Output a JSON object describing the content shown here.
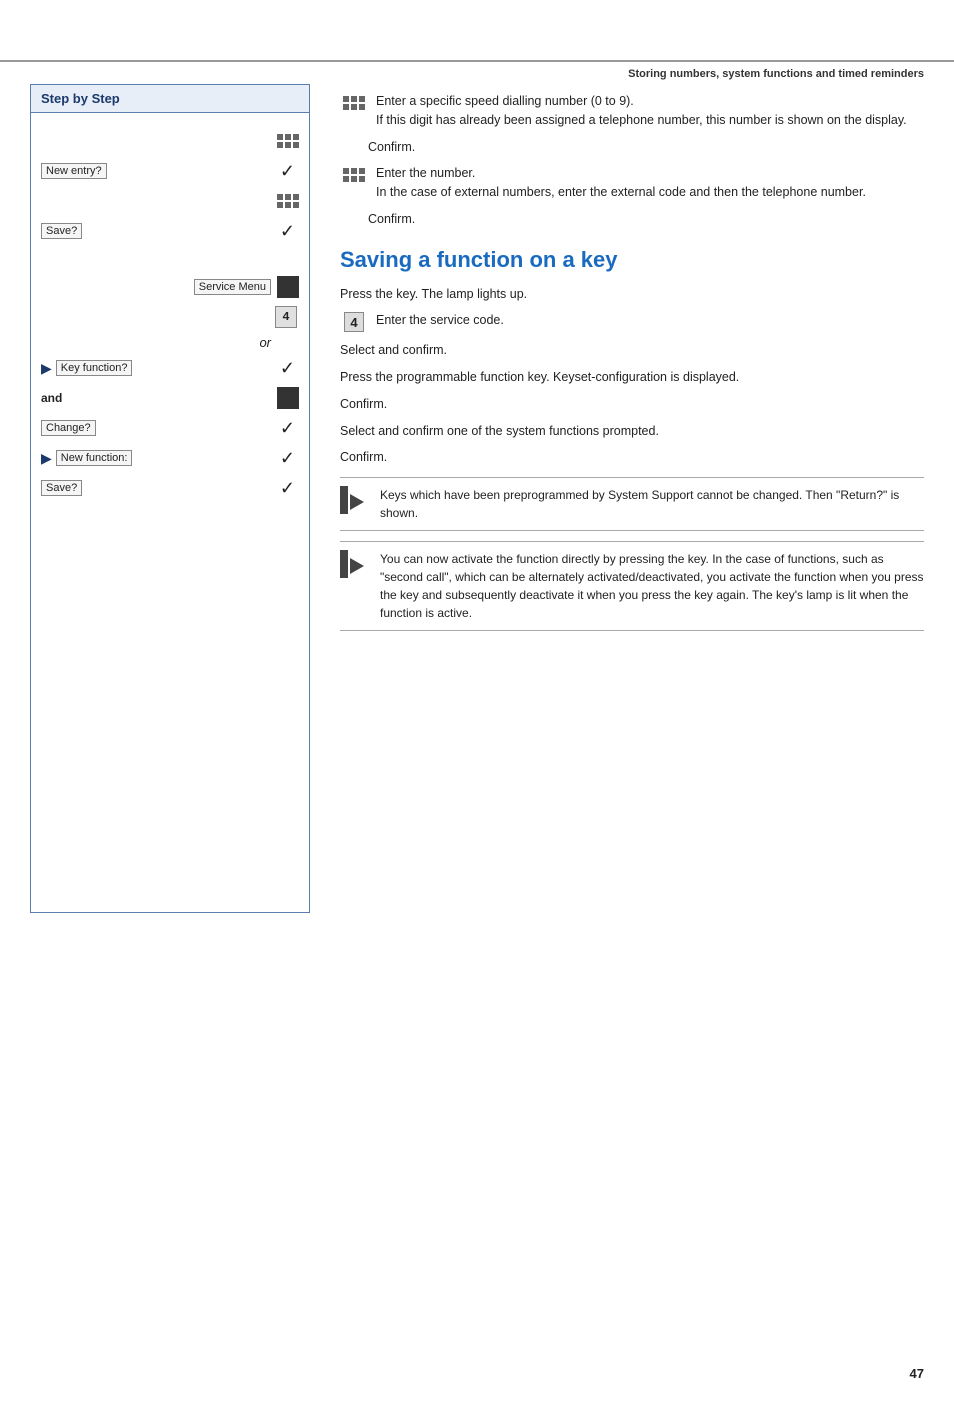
{
  "header": {
    "title": "Storing numbers, system functions and timed reminders"
  },
  "left": {
    "step_by_step_label": "Step by Step",
    "steps": [
      {
        "id": "speed-dial-icon",
        "type": "icon-check",
        "icon": "grid"
      },
      {
        "id": "new-entry",
        "type": "label-check",
        "label": "New entry?"
      },
      {
        "id": "number-icon",
        "type": "icon-check",
        "icon": "grid"
      },
      {
        "id": "save1",
        "type": "label-check",
        "label": "Save?"
      },
      {
        "id": "spacer1",
        "type": "spacer"
      },
      {
        "id": "service-menu",
        "type": "service-menu",
        "label": "Service Menu"
      },
      {
        "id": "digit4",
        "type": "digit",
        "digit": "4"
      },
      {
        "id": "or",
        "type": "or"
      },
      {
        "id": "key-function",
        "type": "arrow-label-check",
        "label": "Key function?"
      },
      {
        "id": "and-key",
        "type": "and-key"
      },
      {
        "id": "change",
        "type": "label-check",
        "label": "Change?"
      },
      {
        "id": "new-function",
        "type": "arrow-label-check",
        "label": "New function:"
      },
      {
        "id": "save2",
        "type": "label-check",
        "label": "Save?"
      }
    ]
  },
  "right": {
    "intro_items": [
      {
        "id": "speed-dial-intro",
        "icon": "grid",
        "text": "Enter a specific speed dialling number (0 to 9). If this digit has already been assigned a telephone number, this number is shown on the display."
      },
      {
        "id": "confirm1",
        "icon": "check",
        "text": "Confirm."
      },
      {
        "id": "enter-number",
        "icon": "grid",
        "text": "Enter the number. In the case of external numbers, enter the external code and then the telephone number."
      },
      {
        "id": "confirm2",
        "icon": "check",
        "text": "Confirm."
      }
    ],
    "section_heading": "Saving a function on a key",
    "section_items": [
      {
        "id": "press-key",
        "text": "Press the key. The lamp lights up."
      },
      {
        "id": "enter-service-code",
        "text": "Enter the service code."
      },
      {
        "id": "select-confirm",
        "text": "Select and confirm."
      },
      {
        "id": "press-prog-key",
        "text": "Press the programmable function key. Keyset-configuration is displayed."
      },
      {
        "id": "confirm3",
        "text": "Confirm."
      },
      {
        "id": "select-confirm2",
        "text": "Select and confirm one of the system functions prompted."
      },
      {
        "id": "confirm4",
        "text": "Confirm."
      }
    ],
    "info_boxes": [
      {
        "id": "info1",
        "text": "Keys which have been preprogrammed by System Support cannot be changed. Then \"Return?\" is shown."
      },
      {
        "id": "info2",
        "text": "You can now activate the function directly by pressing the key. In the case of functions, such as \"second call\", which can be alternately activated/deactivated, you activate the function when you press the key and subsequently deactivate it when you press the key again. The key's lamp is lit when the function is active."
      }
    ]
  },
  "page_number": "47"
}
